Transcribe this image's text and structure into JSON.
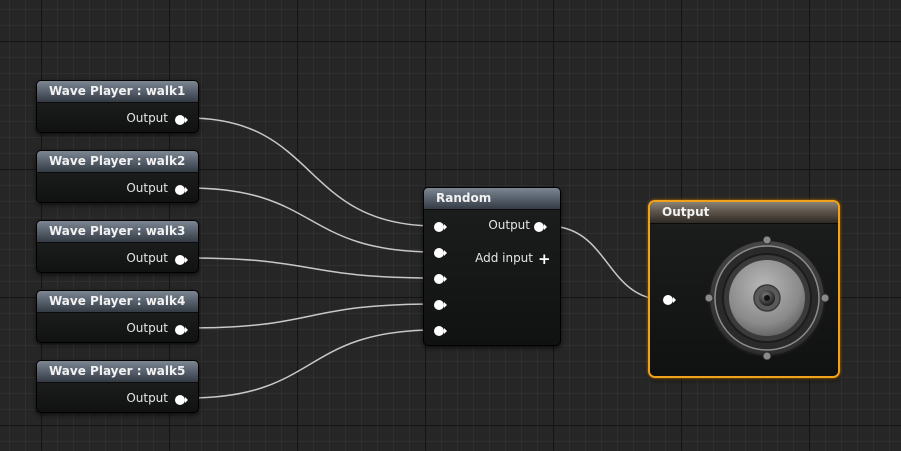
{
  "graph": {
    "wave_players": [
      {
        "title": "Wave Player : walk1",
        "output_label": "Output"
      },
      {
        "title": "Wave Player : walk2",
        "output_label": "Output"
      },
      {
        "title": "Wave Player : walk3",
        "output_label": "Output"
      },
      {
        "title": "Wave Player : walk4",
        "output_label": "Output"
      },
      {
        "title": "Wave Player : walk5",
        "output_label": "Output"
      }
    ],
    "random_node": {
      "title": "Random",
      "output_label": "Output",
      "add_input_label": "Add input",
      "add_input_icon": "plus-icon",
      "input_pin_count": 5
    },
    "output_node": {
      "title": "Output",
      "icon": "speaker-icon",
      "highlight_color": "#f0a21c"
    },
    "colors": {
      "canvas": "#262626",
      "wire": "#c8c8c8",
      "pin": "#ffffff"
    }
  }
}
